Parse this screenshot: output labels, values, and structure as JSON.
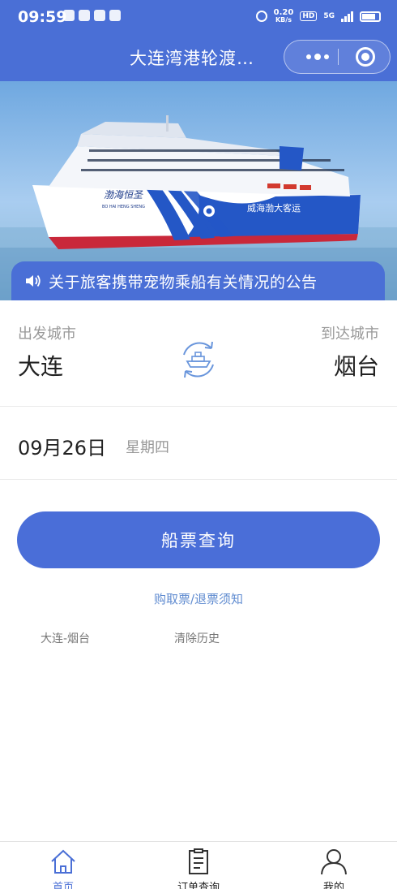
{
  "status_bar": {
    "time": "09:59",
    "net_speed_value": "0.20",
    "net_speed_unit": "KB/s",
    "hd": "HD",
    "signal": "5G"
  },
  "header": {
    "title": "大连湾港轮渡…"
  },
  "banner": {
    "ship_name_cn": "渤海恒圣",
    "ship_name_pinyin": "BO HAI HENG SHENG",
    "ship_hull_text": "威海渤大客运"
  },
  "notice": {
    "text": "关于旅客携带宠物乘船有关情况的公告"
  },
  "route": {
    "from_label": "出发城市",
    "from_city": "大连",
    "to_label": "到达城市",
    "to_city": "烟台"
  },
  "date": {
    "value": "09月26日",
    "weekday": "星期四"
  },
  "search_button": "船票查询",
  "ticket_notice_link": "购取票/退票须知",
  "history": {
    "item": "大连-烟台",
    "clear": "清除历史"
  },
  "tabs": [
    {
      "label": "首页",
      "active": true
    },
    {
      "label": "订单查询",
      "active": false
    },
    {
      "label": "我的",
      "active": false
    }
  ],
  "colors": {
    "primary": "#4a6fd6",
    "link": "#5f8bd0"
  }
}
